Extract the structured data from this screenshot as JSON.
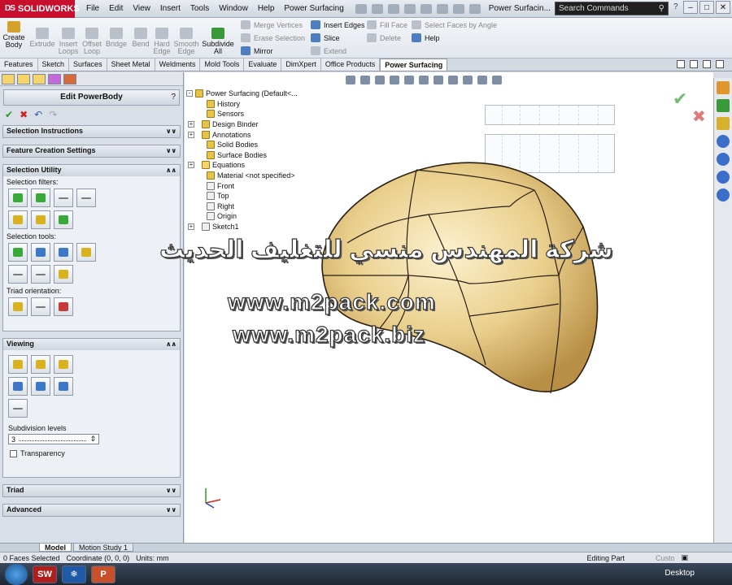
{
  "app": {
    "logo": "SOLIDWORKS",
    "document_title": "Power Surfacin..."
  },
  "menu": [
    "File",
    "Edit",
    "View",
    "Insert",
    "Tools",
    "Window",
    "Help",
    "Power Surfacing"
  ],
  "search": {
    "placeholder": "Search Commands"
  },
  "help_glyph": "?",
  "command_manager": {
    "create_body": "Create Body",
    "buttons": [
      {
        "label": "Extrude",
        "enabled": false
      },
      {
        "label": "Insert Loops",
        "enabled": false
      },
      {
        "label": "Offset Loop",
        "enabled": false
      },
      {
        "label": "Bridge",
        "enabled": false
      },
      {
        "label": "Bend",
        "enabled": false
      },
      {
        "label": "Hard Edge",
        "enabled": false
      },
      {
        "label": "Smooth Edge",
        "enabled": false
      },
      {
        "label": "Subdivide All",
        "enabled": true
      }
    ],
    "col1": [
      "Merge Vertices",
      "Erase Selection",
      "Mirror"
    ],
    "col2": [
      "Insert Edges",
      "Slice",
      "Extend"
    ],
    "col3": [
      "Fill Face",
      "Delete"
    ],
    "col4": [
      "Select Faces by Angle",
      "Help"
    ]
  },
  "tabs": [
    "Features",
    "Sketch",
    "Surfaces",
    "Sheet Metal",
    "Weldments",
    "Mold Tools",
    "Evaluate",
    "DimXpert",
    "Office Products",
    "Power Surfacing"
  ],
  "active_tab": "Power Surfacing",
  "property_manager": {
    "title": "Edit PowerBody",
    "help": "?",
    "sections": {
      "selection_instructions": "Selection Instructions",
      "feature_creation": "Feature Creation Settings",
      "selection_utility": "Selection Utility",
      "viewing": "Viewing",
      "triad": "Triad",
      "advanced": "Advanced"
    },
    "selection_filters_label": "Selection filters:",
    "selection_tools_label": "Selection tools:",
    "triad_orientation_label": "Triad orientation:",
    "subdivision_label": "Subdivision levels",
    "subdivision_value": "3",
    "transparency_label": "Transparency"
  },
  "feature_tree": {
    "root": "Power Surfacing  (Default<...",
    "items": [
      {
        "label": "History",
        "expand": false
      },
      {
        "label": "Sensors",
        "expand": false
      },
      {
        "label": "Design Binder",
        "expand": true
      },
      {
        "label": "Annotations",
        "expand": true
      },
      {
        "label": "Solid Bodies",
        "expand": false
      },
      {
        "label": "Surface Bodies",
        "expand": false
      },
      {
        "label": "Equations",
        "expand": true
      },
      {
        "label": "Material <not specified>",
        "expand": false
      },
      {
        "label": "Front",
        "expand": false
      },
      {
        "label": "Top",
        "expand": false
      },
      {
        "label": "Right",
        "expand": false
      },
      {
        "label": "Origin",
        "expand": false
      },
      {
        "label": "Sketch1",
        "expand": true
      }
    ]
  },
  "watermark": {
    "arabic": "شركة المهندس منسي للتغليف الحديث",
    "url1": "www.m2pack.com",
    "url2": "www.m2pack.biz"
  },
  "model_tabs": [
    "Model",
    "Motion Study 1"
  ],
  "status": {
    "faces": "0 Faces Selected",
    "coordinate": "Coordinate (0, 0, 0)",
    "units": "Units: mm",
    "mode": "Editing Part",
    "custom": "Custo"
  },
  "taskbar": {
    "desktop": "Desktop"
  },
  "colors": {
    "body_fill": "#e9cf8c",
    "accent": "#c8102e"
  }
}
